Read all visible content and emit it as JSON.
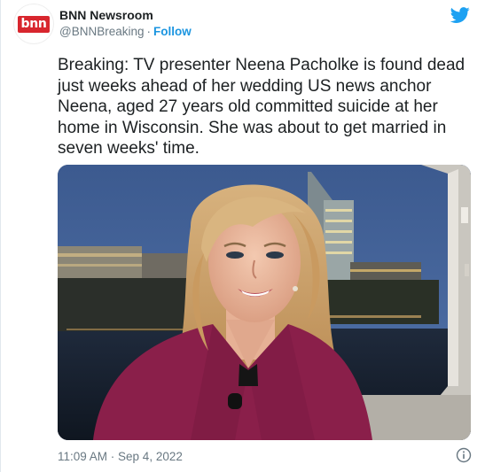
{
  "account": {
    "avatar_text": "bnn",
    "name": "BNN Newsroom",
    "handle": "@BNNBreaking",
    "separator": "·",
    "follow_label": "Follow"
  },
  "tweet": {
    "text": "Breaking: TV presenter Neena Pacholke is found dead just weeks ahead of her wedding US news anchor Neena, aged 27 years old committed suicide at her home in Wisconsin. She was about to get married in seven weeks' time.",
    "timestamp": "11:09 AM · Sep 4, 2022"
  },
  "icons": {
    "brand": "twitter-bird-icon",
    "info": "info-icon"
  },
  "colors": {
    "accent": "#1b95e0",
    "logo_red": "#d8262e",
    "text": "#1c2022",
    "muted": "#697882"
  }
}
